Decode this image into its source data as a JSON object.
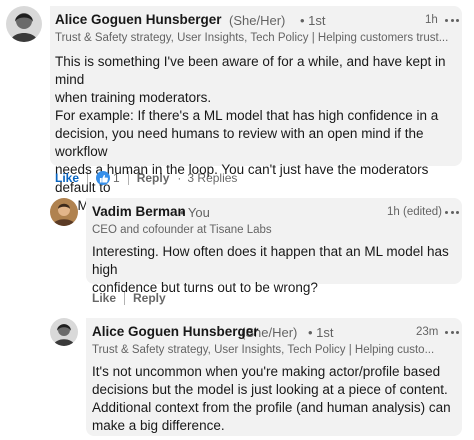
{
  "comments": [
    {
      "author": "Alice Goguen Hunsberger",
      "pronouns": "(She/Her)",
      "degree": "• 1st",
      "headline": "Trust & Safety strategy, User Insights, Tech Policy | Helping customers trust...",
      "time": "1h",
      "text": "This is something I've been aware of for a while, and have kept in mind\nwhen training moderators.\nFor example: If there's a ML model that has high confidence in a\ndecision, you need humans to review with an open mind if the workflow\nneeds a human in the loop. You can't just have the moderators default to\nthe ML's decisions.",
      "like_label": "Like",
      "reaction_count": "1",
      "reply_label": "Reply",
      "replies_count": "3 Replies"
    },
    {
      "author": "Vadim Berman",
      "degree": "• You",
      "headline": "CEO and cofounder at Tisane Labs",
      "time": "1h (edited)",
      "text": "Interesting. How often does it happen that an ML model has high\nconfidence but turns out to be wrong?",
      "like_label": "Like",
      "reply_label": "Reply"
    },
    {
      "author": "Alice Goguen Hunsberger",
      "pronouns": "(She/Her)",
      "degree": "• 1st",
      "headline": "Trust & Safety strategy, User Insights, Tech Policy | Helping custo...",
      "time": "23m",
      "text": "It's not uncommon when you're making actor/profile based\ndecisions but the model is just looking at a piece of content.\nAdditional context from the profile (and human analysis) can\nmake a big difference."
    }
  ],
  "icons": {
    "more": "more-options-icon",
    "reaction": "like-reaction-icon"
  }
}
